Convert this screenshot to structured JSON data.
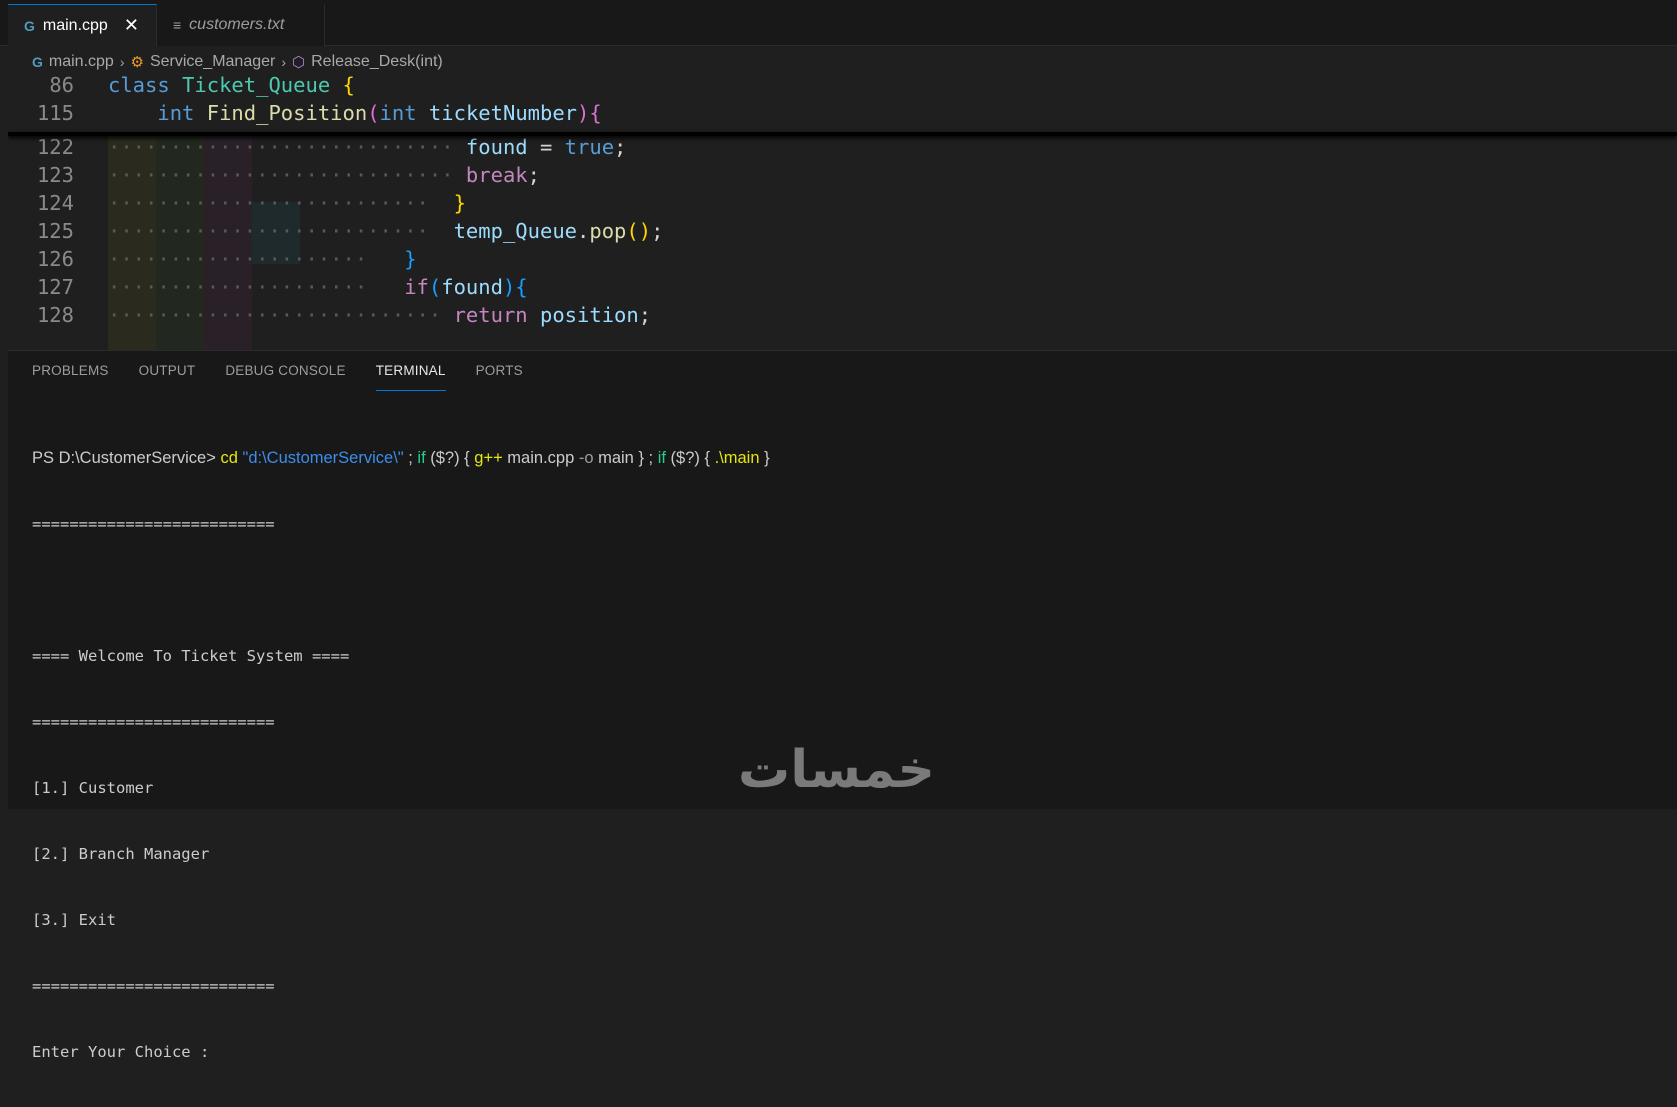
{
  "tabs": [
    {
      "label": "main.cpp",
      "icon": "cpp-file-icon",
      "active": true
    },
    {
      "label": "customers.txt",
      "icon": "text-file-icon",
      "active": false
    }
  ],
  "breadcrumb": {
    "file": "main.cpp",
    "class": "Service_Manager",
    "method": "Release_Desk(int)"
  },
  "editor": {
    "sticky": [
      {
        "num": "86",
        "tokens": [
          [
            "kw",
            "class"
          ],
          [
            "pl",
            " "
          ],
          [
            "cls",
            "Ticket_Queue"
          ],
          [
            "pl",
            " "
          ],
          [
            "br1",
            "{"
          ]
        ]
      },
      {
        "num": "115",
        "tokens": [
          [
            "pl",
            "    "
          ],
          [
            "kw",
            "int"
          ],
          [
            "pl",
            " "
          ],
          [
            "fn",
            "Find_Position"
          ],
          [
            "br2",
            "("
          ],
          [
            "kw",
            "int"
          ],
          [
            "pl",
            " "
          ],
          [
            "var",
            "ticketNumber"
          ],
          [
            "br2",
            ")"
          ],
          [
            "br2",
            "{"
          ]
        ]
      }
    ],
    "lines": [
      {
        "num": "122",
        "tokens": [
          [
            "dots",
            "····························"
          ],
          [
            "pl",
            " "
          ],
          [
            "var",
            "found"
          ],
          [
            "pl",
            " = "
          ],
          [
            "kw",
            "true"
          ],
          [
            "pl",
            ";"
          ]
        ]
      },
      {
        "num": "123",
        "tokens": [
          [
            "dots",
            "····························"
          ],
          [
            "pl",
            " "
          ],
          [
            "kw2",
            "break"
          ],
          [
            "pl",
            ";"
          ]
        ]
      },
      {
        "num": "124",
        "tokens": [
          [
            "dots",
            "··························"
          ],
          [
            "pl",
            "  "
          ],
          [
            "br1",
            "}"
          ]
        ]
      },
      {
        "num": "125",
        "tokens": [
          [
            "dots",
            "··························"
          ],
          [
            "pl",
            "  "
          ],
          [
            "var",
            "temp_Queue"
          ],
          [
            "pl",
            "."
          ],
          [
            "fn",
            "pop"
          ],
          [
            "br1",
            "()"
          ],
          [
            "pl",
            ";"
          ]
        ]
      },
      {
        "num": "126",
        "tokens": [
          [
            "dots",
            "·····················"
          ],
          [
            "pl",
            "   "
          ],
          [
            "br3",
            "}"
          ]
        ]
      },
      {
        "num": "127",
        "tokens": [
          [
            "dots",
            "·····················"
          ],
          [
            "pl",
            "   "
          ],
          [
            "kw2",
            "if"
          ],
          [
            "br3",
            "("
          ],
          [
            "var",
            "found"
          ],
          [
            "br3",
            "){"
          ]
        ]
      },
      {
        "num": "128",
        "tokens": [
          [
            "dots",
            "···························"
          ],
          [
            "pl",
            " "
          ],
          [
            "kw2",
            "return"
          ],
          [
            "pl",
            " "
          ],
          [
            "var",
            "position"
          ],
          [
            "pl",
            ";"
          ]
        ]
      }
    ]
  },
  "panel": {
    "tabs": [
      "PROBLEMS",
      "OUTPUT",
      "DEBUG CONSOLE",
      "TERMINAL",
      "PORTS"
    ],
    "active_tab": "TERMINAL"
  },
  "terminal": {
    "command": {
      "prompt": "PS D:\\CustomerService> ",
      "cd": "cd",
      "path": " \"d:\\CustomerService\\\"",
      "sep1": " ; ",
      "if1": "if",
      "cond1": " ($?) { ",
      "gpp": "g++",
      "args": " main.cpp ",
      "flag": "-o",
      "out": " main } ; ",
      "if2": "if",
      "cond2": " ($?) { ",
      "run": ".\\main",
      "end": " }"
    },
    "output": [
      "==========================",
      "",
      "==== Welcome To Ticket System ====",
      "==========================",
      "[1.] Customer",
      "[2.] Branch Manager",
      "[3.] Exit",
      "==========================",
      "Enter Your Choice :"
    ]
  },
  "watermark": "خمسات",
  "colors": {
    "background": "#1f1f1f",
    "accent": "#0078d4"
  }
}
